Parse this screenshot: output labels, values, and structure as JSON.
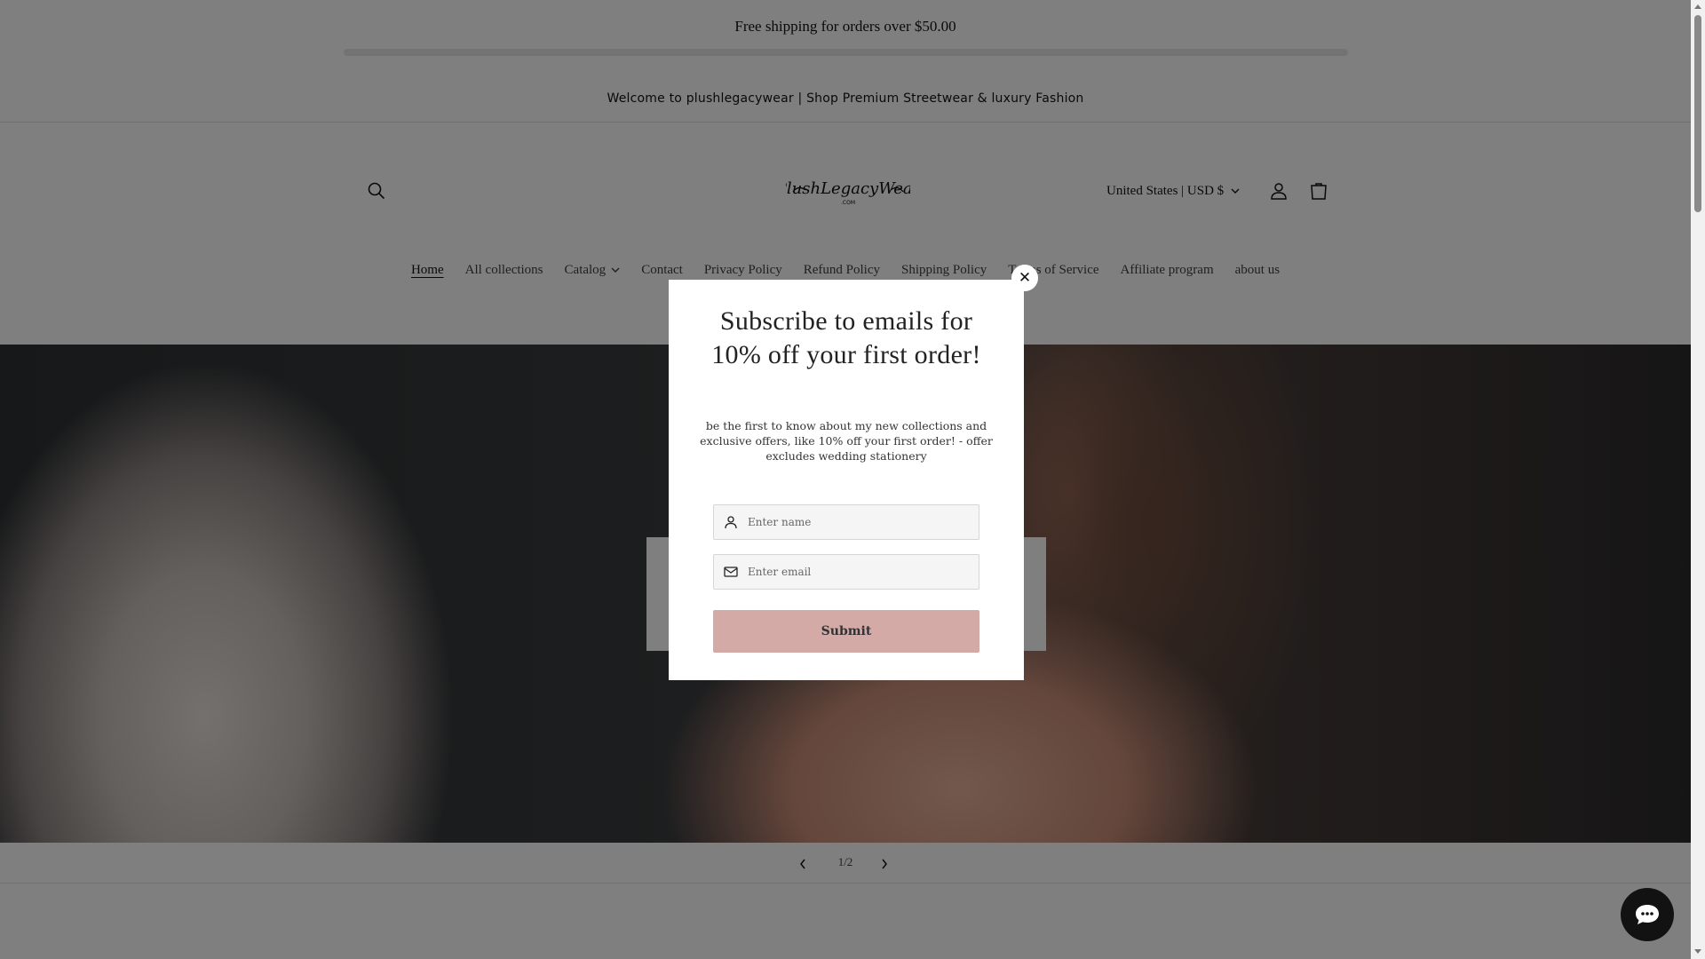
{
  "announcement": {
    "text": "Free shipping for orders over $50.00"
  },
  "welcome": {
    "text": "Welcome to plushlegacywear | Shop Premium Streetwear & luxury Fashion"
  },
  "header": {
    "logo_text": "PlushLegacyWear",
    "logo_subtext": ".COM",
    "country_selector": "United States | USD $",
    "icons": [
      "search-icon",
      "account-icon",
      "cart-icon"
    ]
  },
  "nav": {
    "items": [
      {
        "label": "Home",
        "active": true
      },
      {
        "label": "All collections"
      },
      {
        "label": "Catalog",
        "has_dropdown": true
      },
      {
        "label": "Contact"
      },
      {
        "label": "Privacy Policy"
      },
      {
        "label": "Refund Policy"
      },
      {
        "label": "Shipping Policy"
      },
      {
        "label": "Terms of Service"
      },
      {
        "label": "Affiliate program"
      },
      {
        "label": "about us"
      }
    ]
  },
  "slideshow": {
    "counter": "1/2"
  },
  "popup": {
    "title": "Subscribe to emails for 10% off your first order!",
    "description": "be the first to know about my new collections and exclusive offers, like 10% off your first order! - offer excludes wedding stationery",
    "name_placeholder": "Enter name",
    "email_placeholder": "Enter email",
    "submit_label": "Submit",
    "close_label": "✕"
  },
  "colors": {
    "overlay": "#000000",
    "submit_button": "#d4aaa7",
    "chat_button": "#121212"
  }
}
